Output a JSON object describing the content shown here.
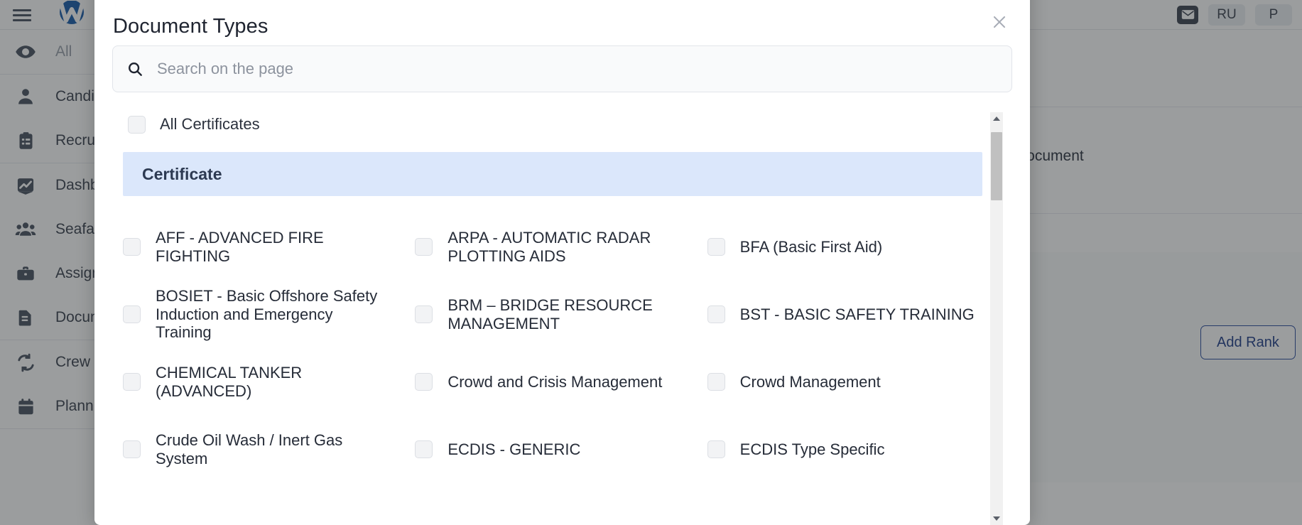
{
  "background": {
    "brand": {
      "name": "app-logo",
      "menu_icon": "hamburger-icon"
    },
    "sidebar": [
      {
        "label": "All",
        "icon": "eye-icon",
        "muted": true
      },
      {
        "label": "Candidates",
        "icon": "user-icon",
        "muted": false
      },
      {
        "label": "Recruitment",
        "icon": "clipboard-icon",
        "muted": false
      },
      {
        "label": "Dashboard",
        "icon": "chart-icon",
        "muted": false
      },
      {
        "label": "Seafarers",
        "icon": "people-icon",
        "muted": false
      },
      {
        "label": "Assignments",
        "icon": "briefcase-icon",
        "muted": false
      },
      {
        "label": "Documents",
        "icon": "document-icon",
        "muted": false
      },
      {
        "label": "Crew Change",
        "icon": "refresh-icon",
        "muted": false
      },
      {
        "label": "Planning",
        "icon": "calendar-icon",
        "muted": false
      }
    ],
    "topbar": {
      "mail_icon": "mail-icon",
      "chips": [
        "RU",
        "P"
      ]
    },
    "subtitle": "Document",
    "rank_button": "Add Rank"
  },
  "modal": {
    "title": "Document Types",
    "close_icon": "close-icon",
    "search": {
      "icon": "search-icon",
      "placeholder": "Search on the page",
      "value": ""
    },
    "select_all": {
      "label": "All Certificates",
      "checked": false
    },
    "group": {
      "label": "Certificate"
    },
    "options": [
      {
        "label": "AFF - ADVANCED FIRE FIGHTING",
        "checked": false
      },
      {
        "label": "ARPA - AUTOMATIC RADAR PLOTTING AIDS",
        "checked": false
      },
      {
        "label": "BFA (Basic First Aid)",
        "checked": false
      },
      {
        "label": "BOSIET - Basic Offshore Safety Induction and Emergency Training",
        "checked": false
      },
      {
        "label": "BRM – BRIDGE RESOURCE MANAGEMENT",
        "checked": false
      },
      {
        "label": "BST - BASIC SAFETY TRAINING",
        "checked": false
      },
      {
        "label": "CHEMICAL TANKER (ADVANCED)",
        "checked": false
      },
      {
        "label": "Crowd and Crisis Management",
        "checked": false
      },
      {
        "label": "Crowd Management",
        "checked": false
      },
      {
        "label": "Crude Oil Wash / Inert Gas System",
        "checked": false
      },
      {
        "label": "ECDIS - GENERIC",
        "checked": false
      },
      {
        "label": "ECDIS Type Specific",
        "checked": false
      }
    ],
    "scrollbar": {
      "up_icon": "scroll-up-arrow",
      "down_icon": "scroll-down-arrow"
    }
  },
  "colors": {
    "group_header_bg": "#dbe7fb",
    "modal_bg": "#ffffff",
    "accent_blue": "#24408a",
    "checkbox_bg": "#f2f3f5",
    "scrim": "rgba(33,37,41,0.45)"
  }
}
